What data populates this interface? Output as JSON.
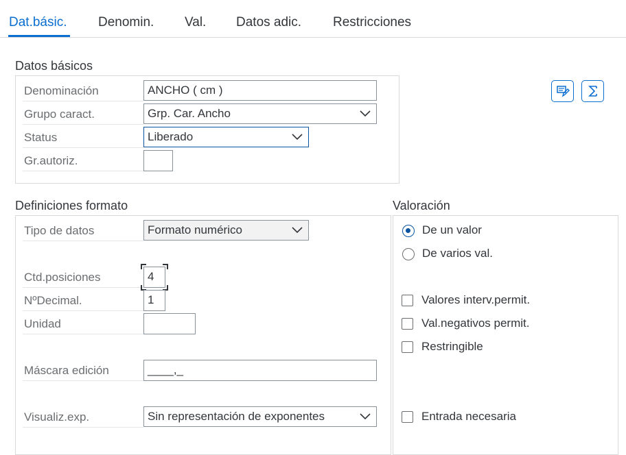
{
  "tabs": [
    {
      "label": "Dat.básic.",
      "active": true
    },
    {
      "label": "Denomin."
    },
    {
      "label": "Val."
    },
    {
      "label": "Datos adic."
    },
    {
      "label": "Restricciones"
    }
  ],
  "datos_basicos": {
    "title": "Datos básicos",
    "denominacion": {
      "label": "Denominación",
      "value": "ANCHO  ( cm )"
    },
    "grupo": {
      "label": "Grupo caract.",
      "value": "Grp. Car. Ancho"
    },
    "status": {
      "label": "Status",
      "value": "Liberado"
    },
    "grautoriz": {
      "label": "Gr.autoriz.",
      "value": ""
    }
  },
  "definiciones": {
    "title": "Definiciones formato",
    "tipo_datos": {
      "label": "Tipo de datos",
      "value": "Formato numérico"
    },
    "ctd_posiciones": {
      "label": "Ctd.posiciones",
      "value": "4"
    },
    "n_decimal": {
      "label": "NºDecimal.",
      "value": "1"
    },
    "unidad": {
      "label": "Unidad",
      "value": ""
    },
    "mascara": {
      "label": "Máscara edición",
      "value": "____,_"
    },
    "visualiz": {
      "label": "Visualiz.exp.",
      "value": "Sin representación de exponentes"
    }
  },
  "valoracion": {
    "title": "Valoración",
    "de_un_valor": {
      "label": "De un valor",
      "selected": true
    },
    "de_varios": {
      "label": "De varios val.",
      "selected": false
    },
    "valores_interv": {
      "label": "Valores interv.permit.",
      "checked": false
    },
    "val_negativos": {
      "label": "Val.negativos permit.",
      "checked": false
    },
    "restringible": {
      "label": "Restringible",
      "checked": false
    },
    "entrada_necesaria": {
      "label": "Entrada necesaria",
      "checked": false
    }
  },
  "icons": {
    "edit_button": "edit-note-icon",
    "sum_button": "sigma-icon"
  },
  "colors": {
    "accent": "#0a6ed1",
    "text": "#32363a",
    "label": "#6a6d70"
  }
}
